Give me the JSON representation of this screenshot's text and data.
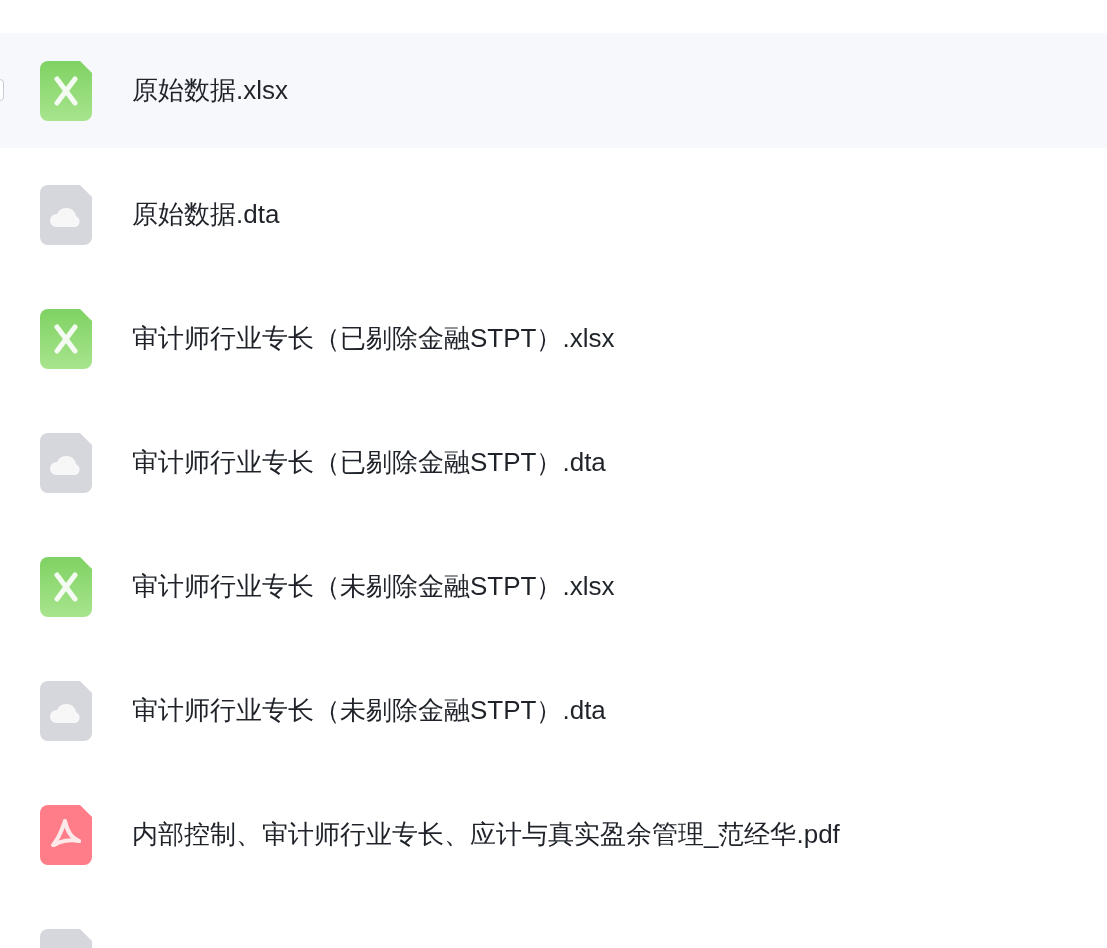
{
  "files": [
    {
      "kind": "excel",
      "name": "原始数据.xlsx",
      "hovered": true
    },
    {
      "kind": "cloud",
      "name": "原始数据.dta",
      "hovered": false
    },
    {
      "kind": "excel",
      "name": "审计师行业专长（已剔除金融STPT）.xlsx",
      "hovered": false
    },
    {
      "kind": "cloud",
      "name": "审计师行业专长（已剔除金融STPT）.dta",
      "hovered": false
    },
    {
      "kind": "excel",
      "name": "审计师行业专长（未剔除金融STPT）.xlsx",
      "hovered": false
    },
    {
      "kind": "cloud",
      "name": "审计师行业专长（未剔除金融STPT）.dta",
      "hovered": false
    },
    {
      "kind": "pdf",
      "name": "内部控制、审计师行业专长、应计与真实盈余管理_范经华.pdf",
      "hovered": false
    },
    {
      "kind": "cloud",
      "hovered": false
    }
  ]
}
